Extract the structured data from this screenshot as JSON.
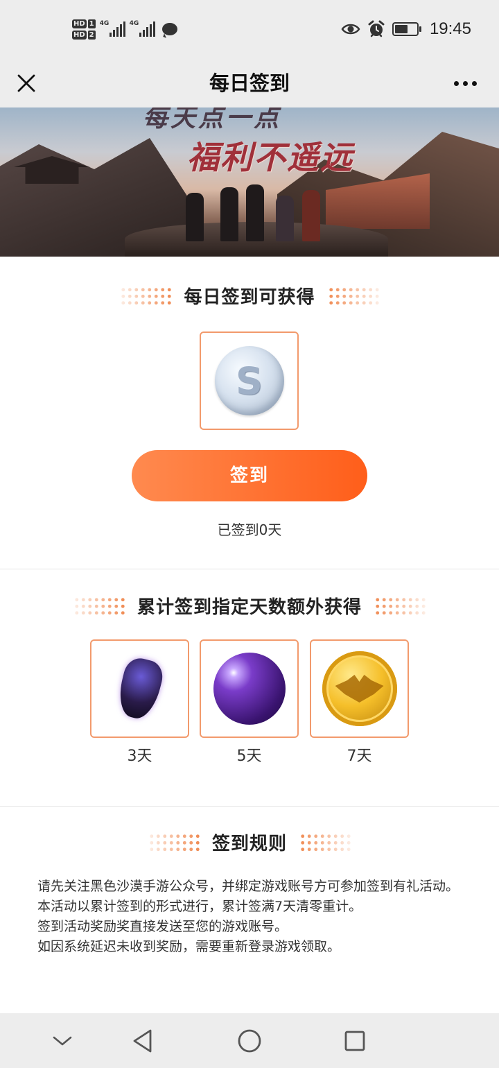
{
  "status_bar": {
    "sim1": "HD",
    "sim1_num": "1",
    "sim2": "HD",
    "sim2_num": "2",
    "network1": "4G",
    "network2": "4G",
    "time": "19:45",
    "icons": [
      "eye-icon",
      "alarm-icon",
      "battery-icon",
      "chat-icon"
    ]
  },
  "header": {
    "title": "每日签到"
  },
  "banner": {
    "line1": "每天点一点",
    "line2": "福利不遥远"
  },
  "daily": {
    "heading": "每日签到可获得",
    "reward_icon": "silver-coin-icon",
    "reward_letter": "S",
    "button_label": "签到",
    "signed_days_text": "已签到0天"
  },
  "cumulative": {
    "heading": "累计签到指定天数额外获得",
    "rewards": [
      {
        "icon": "dark-gem-icon",
        "label": "3天"
      },
      {
        "icon": "purple-orb-icon",
        "label": "5天"
      },
      {
        "icon": "gold-coin-icon",
        "label": "7天"
      }
    ]
  },
  "rules": {
    "heading": "签到规则",
    "lines": [
      "请先关注黑色沙漠手游公众号，并绑定游戏账号方可参加签到有礼活动。",
      "本活动以累计签到的形式进行，累计签满7天清零重计。",
      "签到活动奖励奖直接发送至您的游戏账号。",
      "如因系统延迟未收到奖励，需要重新登录游戏领取。"
    ]
  },
  "colors": {
    "accent": "#ff6a2a",
    "box_border": "#f29a6c",
    "bar_bg": "#ededed"
  }
}
